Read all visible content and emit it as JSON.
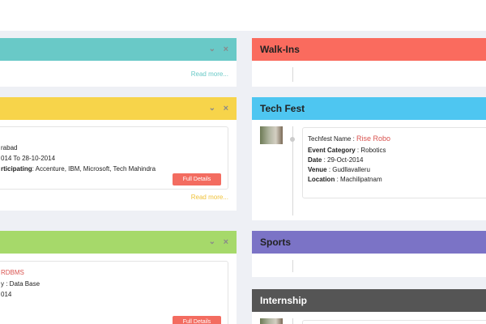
{
  "panel_top_left": {
    "color": "#69c9c7",
    "read_more": "Read more..."
  },
  "panel_mid_left": {
    "color": "#f7d44a",
    "lines": [
      "rabad",
      "014 To 28-10-2014"
    ],
    "participating_label": "rticipating",
    "participating_value": ": Accenture, IBM, Microsoft, Tech Mahindra",
    "full_details": "Full Details",
    "read_more": "Read more..."
  },
  "panel_bottom_left": {
    "color": "#a6d96a",
    "name_fragment": "RDBMS",
    "category_fragment": "y : Data Base",
    "date_fragment": "014",
    "full_details": "Full Details"
  },
  "walkins": {
    "title": "Walk-Ins",
    "color": "#fa6b5e"
  },
  "techfest": {
    "title": "Tech Fest",
    "color": "#4ec6f1",
    "name_label": "Techfest Name :",
    "name_value": "Rise Robo",
    "category_label": "Event Category",
    "category_value": ": Robotics",
    "date_label": "Date",
    "date_value": ": 29-Oct-2014",
    "venue_label": "Venue",
    "venue_value": ": Gudllavalleru",
    "location_label": "Location",
    "location_value": ": Machilipatnam"
  },
  "sports": {
    "title": "Sports",
    "color": "#7b73c6"
  },
  "internship": {
    "title": "Internship",
    "color": "#555555"
  },
  "icons": {
    "collapse": "chevron-down-icon",
    "close": "close-icon"
  }
}
